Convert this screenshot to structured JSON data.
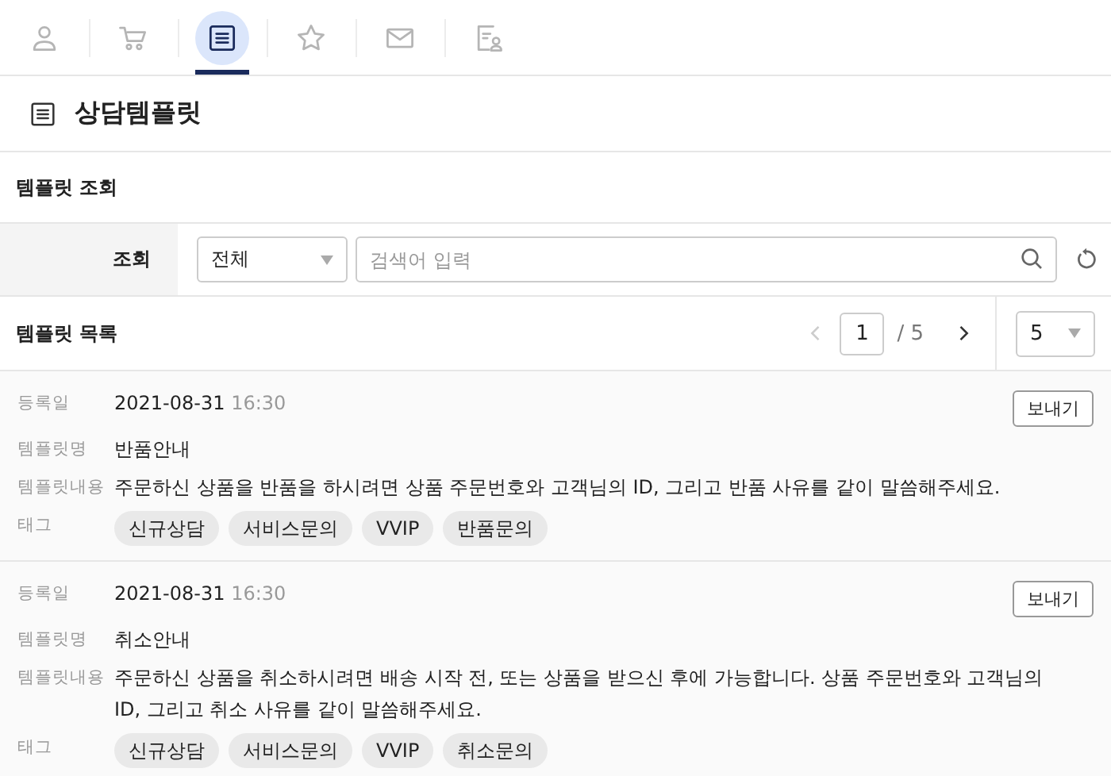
{
  "tabs": [
    {
      "kind": "person",
      "selected": false
    },
    {
      "kind": "cart",
      "selected": false
    },
    {
      "kind": "list",
      "selected": true
    },
    {
      "kind": "star",
      "selected": false
    },
    {
      "kind": "mail",
      "selected": false
    },
    {
      "kind": "profile",
      "selected": false
    }
  ],
  "header": {
    "title": "상담템플릿"
  },
  "search_section": {
    "title": "템플릿 조회",
    "label": "조회",
    "category": "전체",
    "placeholder": "검색어 입력"
  },
  "list_section": {
    "title": "템플릿 목록",
    "page": "1",
    "total_pages": "/ 5",
    "page_size": "5"
  },
  "templates": [
    {
      "date_label": "등록일",
      "date": "2021-08-31",
      "time": "16:30",
      "name_label": "템플릿명",
      "name": "반품안내",
      "content_label": "템플릿내용",
      "content": "주문하신 상품을 반품을 하시려면 상품 주문번호와 고객님의 ID, 그리고 반품 사유를 같이 말씀해주세요.",
      "tag_label": "태그",
      "tags": [
        "신규상담",
        "서비스문의",
        "VVIP",
        "반품문의"
      ],
      "button": "보내기"
    },
    {
      "date_label": "등록일",
      "date": "2021-08-31",
      "time": "16:30",
      "name_label": "템플릿명",
      "name": "취소안내",
      "content_label": "템플릿내용",
      "content": "주문하신 상품을 취소하시려면 배송 시작 전, 또는 상품을 받으신 후에 가능합니다. 상품 주문번호와 고객님의 ID, 그리고 취소 사유를 같이 말씀해주세요.",
      "tag_label": "태그",
      "tags": [
        "신규상담",
        "서비스문의",
        "VVIP",
        "취소문의"
      ],
      "button": "보내기"
    }
  ]
}
